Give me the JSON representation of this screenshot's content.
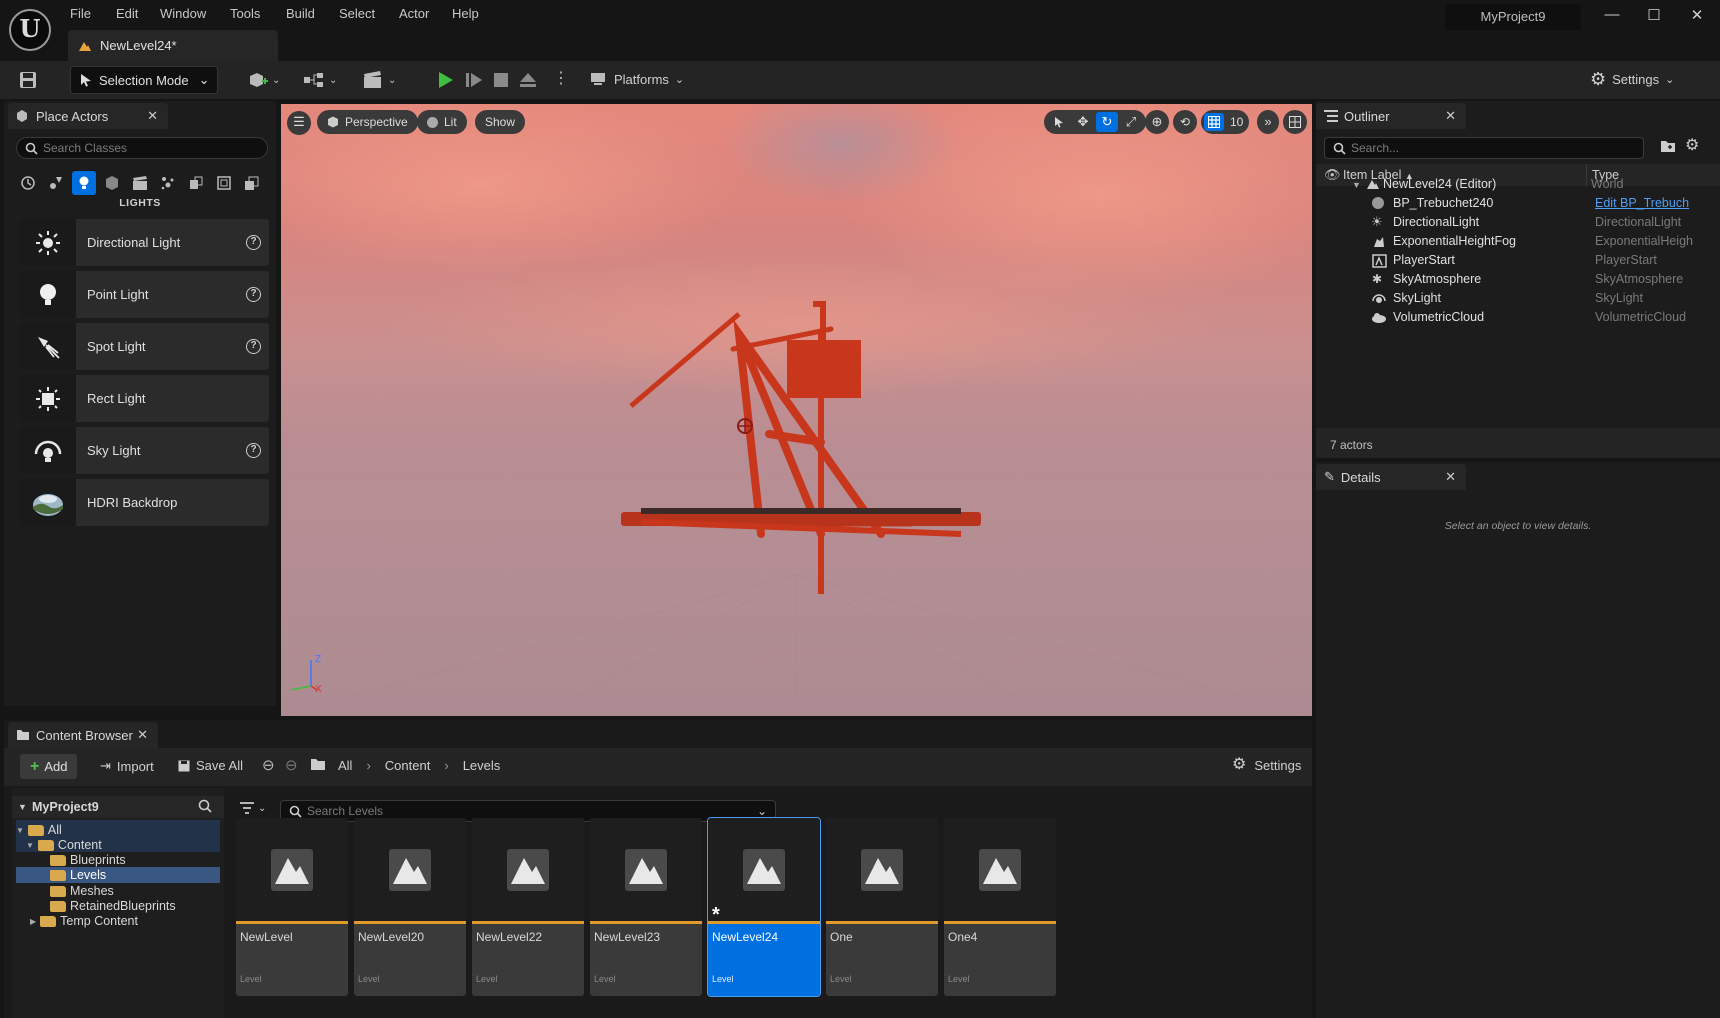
{
  "app": {
    "logo_letter": "U",
    "menu": [
      "File",
      "Edit",
      "Window",
      "Tools",
      "Build",
      "Select",
      "Actor",
      "Help"
    ],
    "document_tab": "NewLevel24*",
    "project_name": "MyProject9"
  },
  "toolbar": {
    "mode_label": "Selection Mode",
    "platforms_label": "Platforms",
    "settings_label": "Settings"
  },
  "place_actors": {
    "tab_label": "Place Actors",
    "search_placeholder": "Search Classes",
    "category_label": "LIGHTS",
    "items": [
      {
        "label": "Directional Light",
        "icon": "directional-light-icon",
        "help": true
      },
      {
        "label": "Point Light",
        "icon": "point-light-icon",
        "help": true
      },
      {
        "label": "Spot Light",
        "icon": "spot-light-icon",
        "help": true
      },
      {
        "label": "Rect Light",
        "icon": "rect-light-icon",
        "help": false
      },
      {
        "label": "Sky Light",
        "icon": "sky-light-icon",
        "help": true
      },
      {
        "label": "HDRI Backdrop",
        "icon": "hdri-backdrop-icon",
        "help": false
      }
    ]
  },
  "viewport": {
    "perspective_label": "Perspective",
    "lit_label": "Lit",
    "show_label": "Show",
    "grid_snap_value": "10",
    "axis_z": "Z",
    "axis_x": "X"
  },
  "outliner": {
    "tab_label": "Outliner",
    "search_placeholder": "Search...",
    "col_label": "Item Label",
    "col_type": "Type",
    "root": {
      "name": "NewLevel24 (Editor)",
      "type": "World"
    },
    "items": [
      {
        "name": "BP_Trebuchet240",
        "type": "Edit BP_Trebuch"
      },
      {
        "name": "DirectionalLight",
        "type": "DirectionalLight"
      },
      {
        "name": "ExponentialHeightFog",
        "type": "ExponentialHeigh"
      },
      {
        "name": "PlayerStart",
        "type": "PlayerStart"
      },
      {
        "name": "SkyAtmosphere",
        "type": "SkyAtmosphere"
      },
      {
        "name": "SkyLight",
        "type": "SkyLight"
      },
      {
        "name": "VolumetricCloud",
        "type": "VolumetricCloud"
      }
    ],
    "actor_count": "7 actors"
  },
  "details": {
    "tab_label": "Details",
    "empty_message": "Select an object to view details."
  },
  "content_browser": {
    "tab_label": "Content Browser",
    "add_label": "Add",
    "import_label": "Import",
    "save_all_label": "Save All",
    "breadcrumb": [
      "All",
      "Content",
      "Levels"
    ],
    "settings_label": "Settings",
    "project_label": "MyProject9",
    "search_placeholder": "Search Levels",
    "tree": [
      "All",
      "Content",
      "Blueprints",
      "Levels",
      "Meshes",
      "RetainedBlueprints",
      "Temp Content"
    ],
    "assets": [
      {
        "name": "NewLevel",
        "type": "Level"
      },
      {
        "name": "NewLevel20",
        "type": "Level"
      },
      {
        "name": "NewLevel22",
        "type": "Level"
      },
      {
        "name": "NewLevel23",
        "type": "Level"
      },
      {
        "name": "NewLevel24",
        "type": "Level"
      },
      {
        "name": "One",
        "type": "Level"
      },
      {
        "name": "One4",
        "type": "Level"
      }
    ],
    "selected_asset": "NewLevel24"
  },
  "colors": {
    "accent_blue": "#0070e0",
    "play_green": "#3fbf3f",
    "asset_underline": "#e09a2a",
    "trebuchet_red": "#c8361c"
  }
}
